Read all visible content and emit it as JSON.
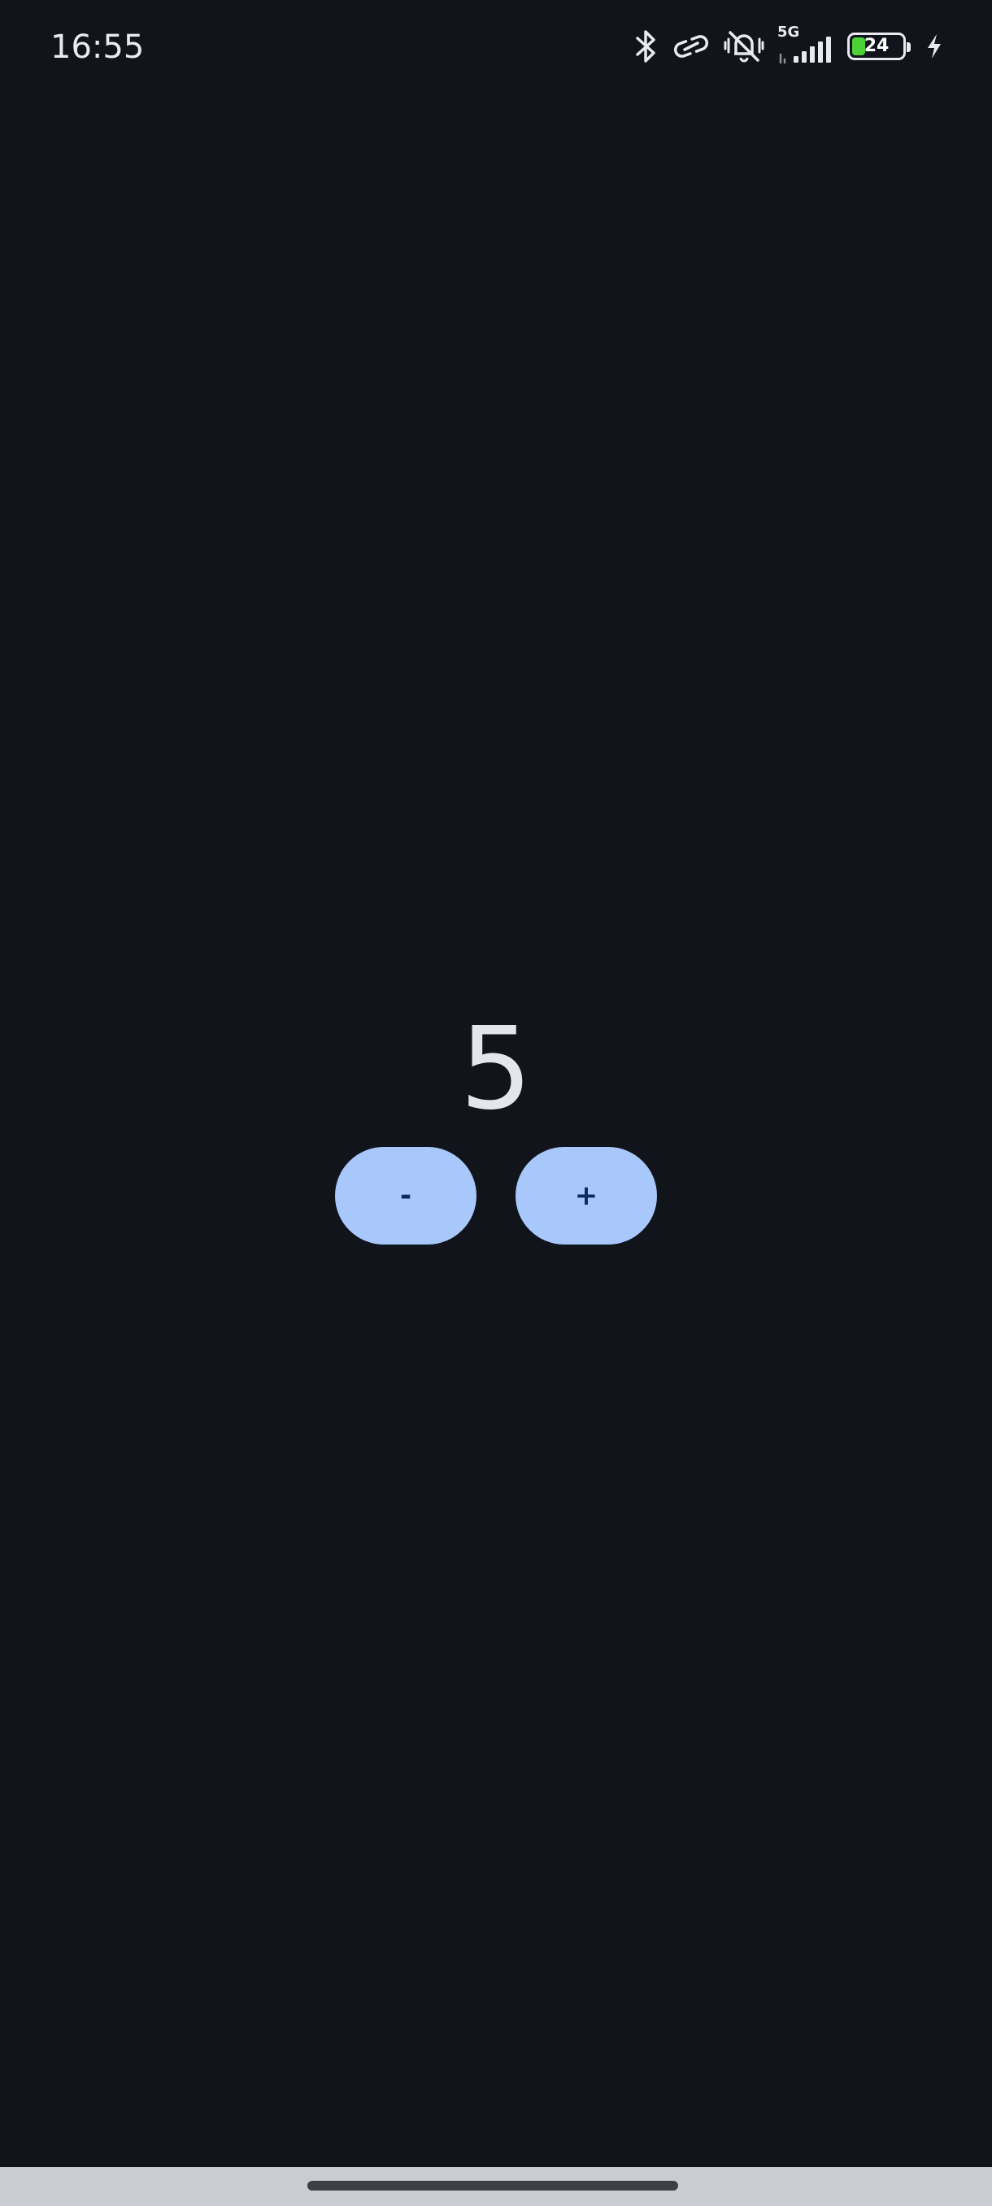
{
  "status_bar": {
    "time": "16:55",
    "network_label": "5G",
    "battery_level": "24",
    "icons": [
      "bluetooth-icon",
      "link-icon",
      "vibrate-off-icon",
      "signal-icon",
      "battery-icon",
      "charging-icon"
    ]
  },
  "counter": {
    "value": "5"
  },
  "buttons": {
    "decrement_label": "-",
    "increment_label": "+"
  },
  "colors": {
    "background": "#11141b",
    "button_fill": "#a8c7fa",
    "button_text": "#0c2a5a",
    "counter_text": "#e4e6ec",
    "battery_fill": "#4cd137",
    "nav_bar": "#c9cdd1"
  }
}
